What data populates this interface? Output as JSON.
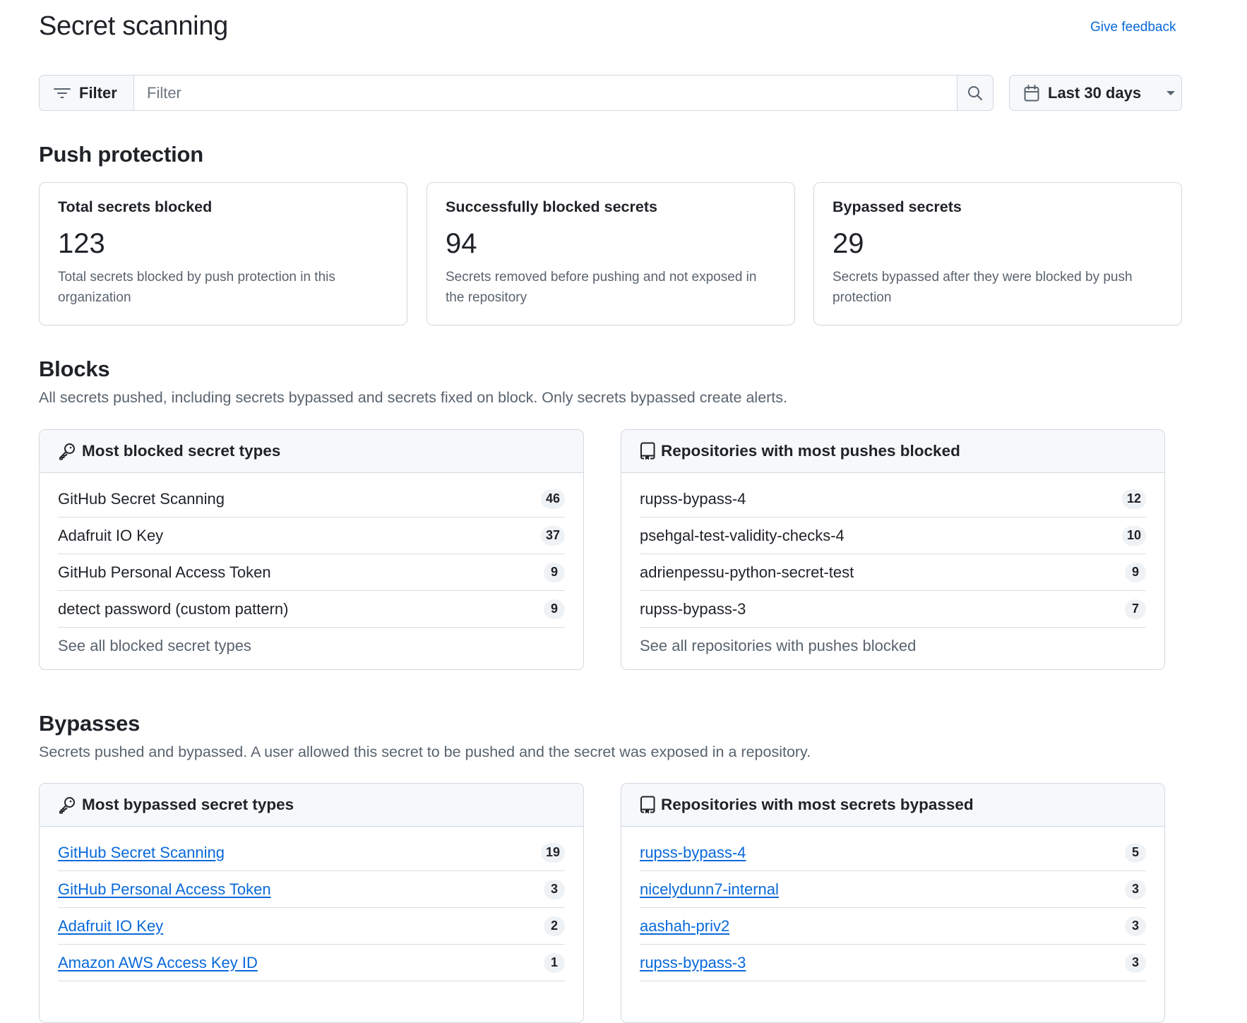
{
  "page": {
    "title": "Secret scanning",
    "feedback_link": "Give feedback"
  },
  "toolbar": {
    "filter_button_label": "Filter",
    "filter_placeholder": "Filter",
    "filter_value": "",
    "date_range_label": "Last 30 days"
  },
  "push_protection": {
    "title": "Push protection",
    "stats": [
      {
        "title": "Total secrets blocked",
        "value": "123",
        "description": "Total secrets blocked by push protection in this organization"
      },
      {
        "title": "Successfully blocked secrets",
        "value": "94",
        "description": "Secrets removed before pushing and not exposed in the repository"
      },
      {
        "title": "Bypassed secrets",
        "value": "29",
        "description": "Secrets bypassed after they were blocked by push protection"
      }
    ]
  },
  "blocks": {
    "title": "Blocks",
    "description": "All secrets pushed, including secrets bypassed and secrets fixed on block. Only secrets bypassed create alerts.",
    "secret_types": {
      "header": "Most blocked secret types",
      "icon": "key-icon",
      "items": [
        {
          "label": "GitHub Secret Scanning",
          "count": "46"
        },
        {
          "label": "Adafruit IO Key",
          "count": "37"
        },
        {
          "label": "GitHub Personal Access Token",
          "count": "9"
        },
        {
          "label": "detect password (custom pattern)",
          "count": "9"
        }
      ],
      "see_all": "See all blocked secret types"
    },
    "repositories": {
      "header": "Repositories with most pushes blocked",
      "icon": "repo-icon",
      "items": [
        {
          "label": "rupss-bypass-4",
          "count": "12"
        },
        {
          "label": "psehgal-test-validity-checks-4",
          "count": "10"
        },
        {
          "label": "adrienpessu-python-secret-test",
          "count": "9"
        },
        {
          "label": "rupss-bypass-3",
          "count": "7"
        }
      ],
      "see_all": "See all repositories with pushes blocked"
    }
  },
  "bypasses": {
    "title": "Bypasses",
    "description": "Secrets pushed and bypassed. A user allowed this secret to be pushed and the secret was exposed in a repository.",
    "secret_types": {
      "header": "Most bypassed secret types",
      "icon": "key-icon",
      "items": [
        {
          "label": "GitHub Secret Scanning",
          "count": "19"
        },
        {
          "label": "GitHub Personal Access Token",
          "count": "3"
        },
        {
          "label": "Adafruit IO Key",
          "count": "2"
        },
        {
          "label": "Amazon AWS Access Key ID",
          "count": "1"
        }
      ]
    },
    "repositories": {
      "header": "Repositories with most secrets bypassed",
      "icon": "repo-icon",
      "items": [
        {
          "label": "rupss-bypass-4",
          "count": "5"
        },
        {
          "label": "nicelydunn7-internal",
          "count": "3"
        },
        {
          "label": "aashah-priv2",
          "count": "3"
        },
        {
          "label": "rupss-bypass-3",
          "count": "3"
        }
      ]
    }
  },
  "colors": {
    "link": "#0969da",
    "text": "#1f2328",
    "muted": "#59636e",
    "border": "#d1d9e0",
    "subtle_bg": "#f6f8fa",
    "badge_bg": "#eff2f5"
  }
}
